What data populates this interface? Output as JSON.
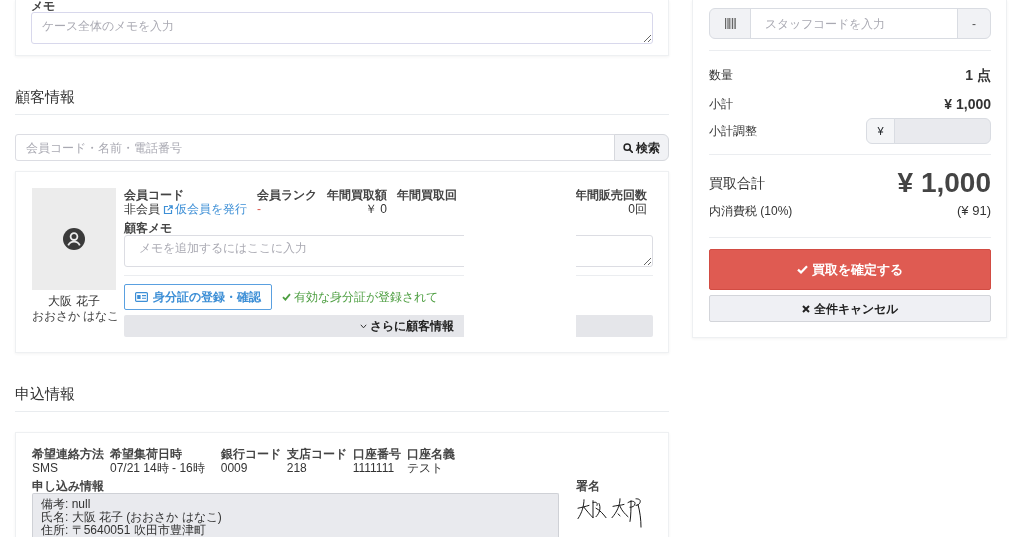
{
  "memo": {
    "label": "メモ",
    "placeholder": "ケース全体のメモを入力"
  },
  "customer_section": {
    "title": "顧客情報",
    "search": {
      "placeholder": "会員コード・名前・電話番号",
      "button": "検索"
    },
    "customer": {
      "name": "大阪 花子",
      "kana": "おおさか はなこ",
      "fields": [
        {
          "kind": "member_code",
          "label": "会員コード",
          "value": "非会員",
          "link": "仮会員を発行"
        },
        {
          "kind": "rank",
          "label": "会員ランク",
          "value": "-"
        },
        {
          "kind": "stat",
          "label": "年間買取額",
          "value": "￥ 0"
        },
        {
          "kind": "stat",
          "label": "年間買取回"
        },
        {
          "kind": "stat",
          "label": "年間販売回数",
          "value": "0回"
        }
      ],
      "memo": {
        "label": "顧客メモ",
        "placeholder": "メモを追加するにはここに入力"
      },
      "id_button": "身分証の登録・確認",
      "id_status": "有効な身分証が登録されて",
      "more_button": "さらに顧客情報"
    }
  },
  "application_section": {
    "title": "申込情報",
    "fields": [
      {
        "label": "希望連絡方法",
        "value": "SMS"
      },
      {
        "label": "希望集荷日時",
        "value": "07/21 14時 - 16時"
      },
      {
        "label": "銀行コード",
        "value": "0009"
      },
      {
        "label": "支店コード",
        "value": "218"
      },
      {
        "label": "口座番号",
        "value": "1111111"
      },
      {
        "label": "口座名義",
        "value": "テスト"
      }
    ],
    "details": {
      "label": "申し込み情報",
      "lines": [
        "備考: null",
        "氏名: 大阪 花子 (おおさか はなこ)",
        "住所: 〒5640051 吹田市豊津町"
      ]
    },
    "signature": {
      "label": "署名"
    }
  },
  "summary": {
    "staff": {
      "placeholder": "スタッフコードを入力",
      "staff_name": "-"
    },
    "rows": [
      {
        "label": "数量",
        "value": "1 点"
      },
      {
        "label": "小計",
        "value": "¥ 1,000"
      }
    ],
    "adjustment": {
      "label": "小計調整",
      "prefix": "¥",
      "disabled": true
    },
    "total": {
      "label": "買取合計",
      "value": "¥ 1,000"
    },
    "tax": {
      "label": "内消費税 (10%)",
      "value": "(¥ 91)"
    },
    "confirm_button": "買取を確定する",
    "cancel_button": "全件キャンセル"
  }
}
